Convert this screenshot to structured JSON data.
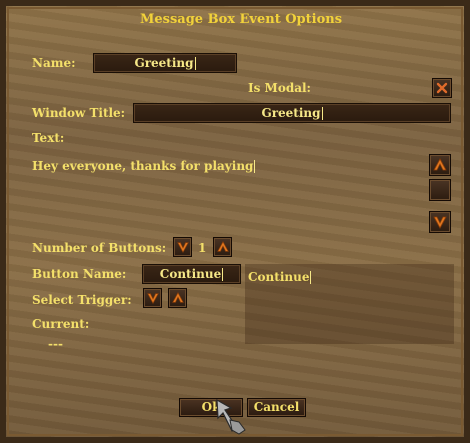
{
  "window": {
    "title": "Message Box Event Options"
  },
  "fields": {
    "name_label": "Name:",
    "name_value": "Greeting",
    "modal_label": "Is Modal:",
    "window_title_label": "Window Title:",
    "window_title_value": "Greeting",
    "text_label": "Text:",
    "text_value": "Hey everyone, thanks for playing",
    "num_buttons_label": "Number of Buttons:",
    "num_buttons_value": "1",
    "button_name_label": "Button Name:",
    "button_name_value": "Continue",
    "button_preview": "Continue",
    "select_trigger_label": "Select Trigger:",
    "current_label": "Current:",
    "current_value": "---"
  },
  "buttons": {
    "ok": "Ok",
    "cancel": "Cancel"
  },
  "colors": {
    "label": "#f4e06a",
    "title": "#f2d23a",
    "arrow": "#e07820",
    "close_x": "#e06a2a"
  },
  "icons": [
    "close-icon",
    "arrow-up-icon",
    "arrow-down-icon",
    "cursor-icon"
  ]
}
